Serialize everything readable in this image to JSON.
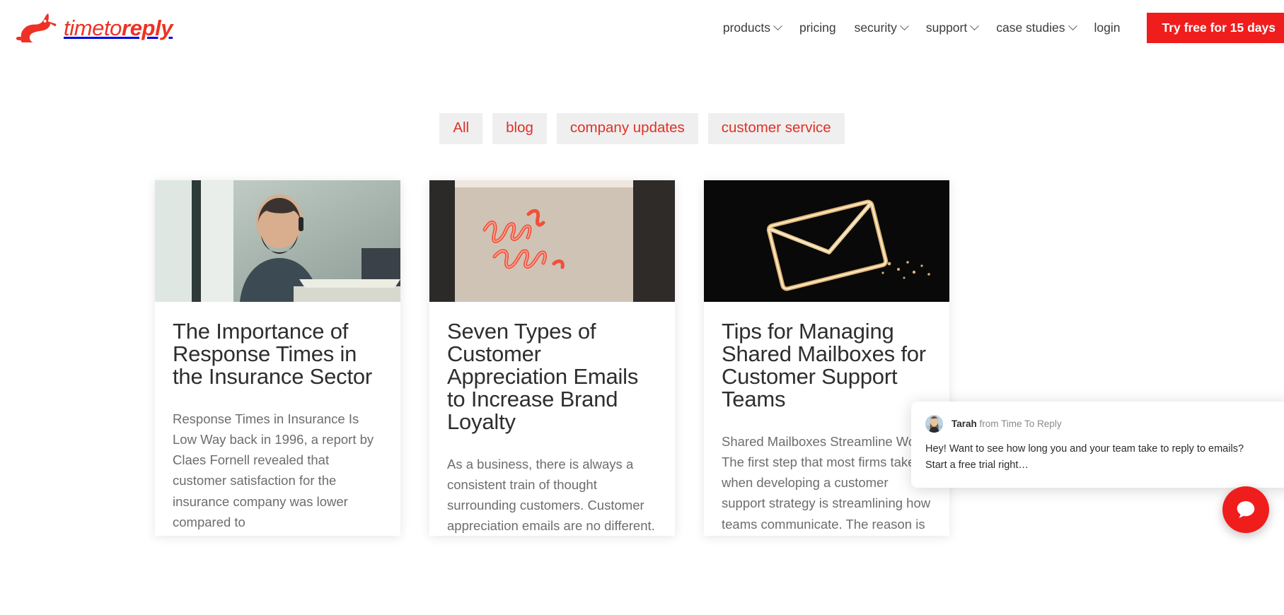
{
  "header": {
    "logo": {
      "icon": "rabbit-logo-icon",
      "text_light": "timeto",
      "text_bold": "reply",
      "color": "#ee3124"
    },
    "nav": [
      {
        "label": "products",
        "has_dropdown": true
      },
      {
        "label": "pricing",
        "has_dropdown": false
      },
      {
        "label": "security",
        "has_dropdown": true
      },
      {
        "label": "support",
        "has_dropdown": true
      },
      {
        "label": "case studies",
        "has_dropdown": true
      },
      {
        "label": "login",
        "has_dropdown": false
      }
    ],
    "cta": {
      "label": "Try free for 15 days",
      "color": "#f01d1d"
    }
  },
  "filters": {
    "tabs": [
      {
        "label": "All",
        "active": true
      },
      {
        "label": "blog",
        "active": false
      },
      {
        "label": "company updates",
        "active": false
      },
      {
        "label": "customer service",
        "active": false
      }
    ],
    "text_color": "#e03127",
    "bg_color": "#efefef"
  },
  "articles": [
    {
      "image_alt": "smiling-man-with-headset-at-laptop",
      "title": "The Importance of Response Times in the Insurance Sector",
      "excerpt": "Response Times in Insurance Is Low Way back in 1996, a report by Claes Fornell revealed that customer satisfaction for the insurance company was lower compared to"
    },
    {
      "image_alt": "thank-you-neon-sign-on-wall",
      "title": "Seven Types of Customer Appreciation Emails to Increase Brand Loyalty",
      "excerpt": "As a business, there is always a consistent train of thought surrounding customers. Customer appreciation emails are no different."
    },
    {
      "image_alt": "neon-envelope-sign-on-dark-background",
      "title": "Tips for Managing Shared Mailboxes for Customer Support Teams",
      "excerpt": "Shared Mailboxes Streamline Work The first step that most firms take when developing a customer support strategy is streamlining how teams communicate. The reason is"
    }
  ],
  "chat": {
    "agent_name": "Tarah",
    "agent_from": "from Time To Reply",
    "message": "Hey! Want to see how long you and your team take to reply to emails?  Start a free trial right…",
    "launcher_icon": "chat-bubble-icon",
    "launcher_color": "#f01d1d"
  }
}
